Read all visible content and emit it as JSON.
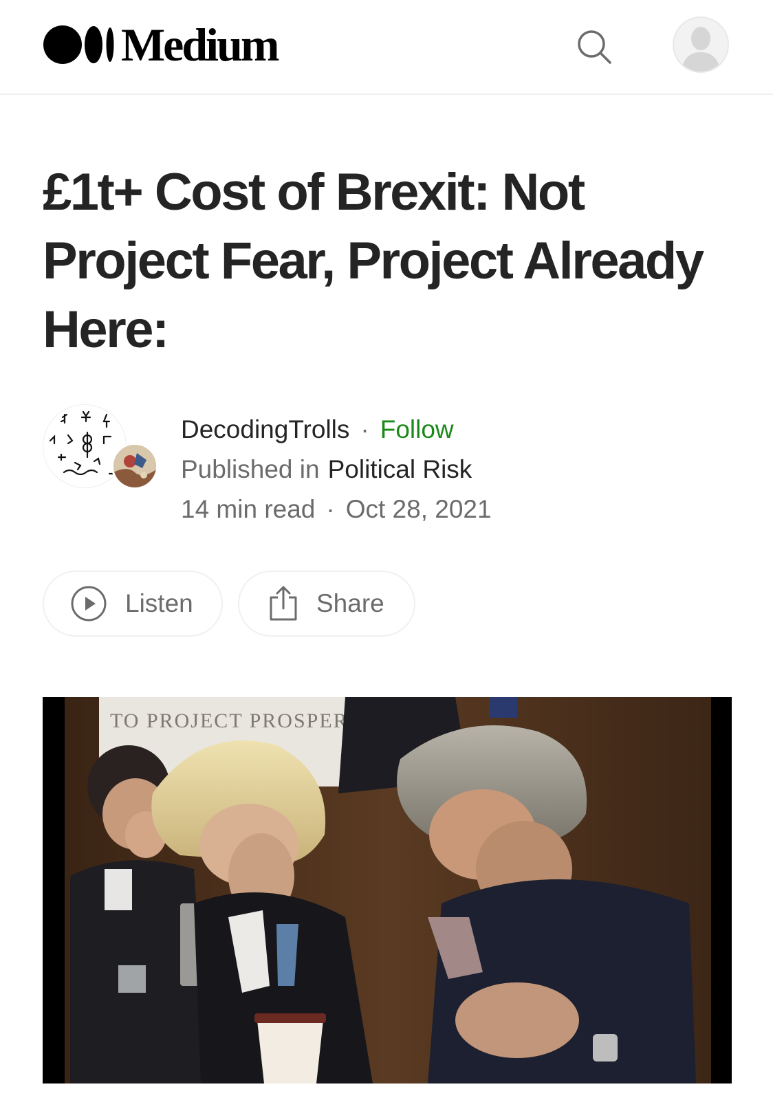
{
  "header": {
    "logo_text": "Medium",
    "logo_icon": "medium-dots-logo",
    "search_icon": "search-icon",
    "avatar_icon": "user-avatar-icon"
  },
  "article": {
    "title": "£1t+ Cost of Brexit: Not Project Fear, Project Already Here:",
    "author": "DecodingTrolls",
    "separator": "·",
    "follow_label": "Follow",
    "published_in_label": "Published in",
    "publication": "Political Risk",
    "read_time": "14 min read",
    "date": "Oct 28, 2021"
  },
  "actions": {
    "listen_label": "Listen",
    "listen_icon": "play-circle-icon",
    "share_label": "Share",
    "share_icon": "share-icon"
  },
  "hero": {
    "banner_text": "TO PROJECT PROSPER"
  },
  "colors": {
    "text": "#242424",
    "muted": "#6b6b6b",
    "follow": "#1a8917",
    "border": "#f0f0f0"
  }
}
